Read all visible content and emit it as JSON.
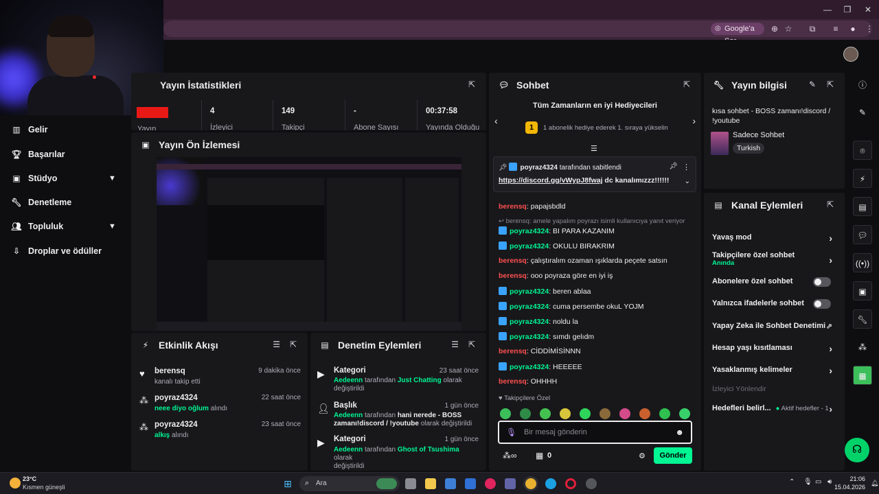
{
  "browser": {
    "google_sor_label": "Google'a Sor"
  },
  "sidebar": {
    "items": [
      {
        "label": "Gelir",
        "icon": "bar-chart-icon"
      },
      {
        "label": "Başarılar",
        "icon": "trophy-icon"
      },
      {
        "label": "Stüdyo",
        "icon": "studio-icon"
      },
      {
        "label": "Denetleme",
        "icon": "wrench-icon"
      },
      {
        "label": "Topluluk",
        "icon": "people-icon"
      },
      {
        "label": "Droplar ve ödüller",
        "icon": "gift-icon"
      }
    ]
  },
  "stats_panel": {
    "title": "Yayın İstatistikleri",
    "stats": [
      {
        "value": "4",
        "label": "İzleyici"
      },
      {
        "value": "149",
        "label": "Takipçi"
      },
      {
        "value": "-",
        "label": "Abone Sayısı"
      },
      {
        "value": "00:37:58",
        "label": "Yayında Olduğu"
      }
    ],
    "first_label": "Yayın"
  },
  "preview_panel": {
    "title": "Yayın Ön İzlemesi"
  },
  "activity_panel": {
    "title": "Etkinlik Akışı",
    "items": [
      {
        "name": "berensq",
        "sub": "kanalı takip etti",
        "time": "9 dakika önce",
        "icon": "heart-icon"
      },
      {
        "name": "poyraz4324",
        "sub_highlight": "neee diyo oğlum",
        "sub_rest": "alındı",
        "time": "22 saat önce",
        "icon": "points-icon"
      },
      {
        "name": "poyraz4324",
        "sub_highlight": "alkış",
        "sub_rest": "alındı",
        "time": "23 saat önce",
        "icon": "points-icon"
      }
    ]
  },
  "mod_panel": {
    "title": "Denetim Eylemleri",
    "items": [
      {
        "kind": "Kategori",
        "time": "23 saat önce",
        "user": "Aedeenn",
        "mid": "tarafından",
        "value": "Just Chatting",
        "rest1": "olarak",
        "rest2": "değiştirildi"
      },
      {
        "kind": "Başlık",
        "time": "1 gün önce",
        "user": "Aedeenn",
        "mid": "tarafından",
        "value": "hani nerede - BOSS",
        "value2": "zamanı!discord / !youtube",
        "rest1": "olarak değiştirildi"
      },
      {
        "kind": "Kategori",
        "time": "1 gün önce",
        "user": "Aedeenn",
        "mid": "tarafından",
        "value": "Ghost of Tsushima",
        "rest1": "olarak",
        "rest2": "değiştirildi"
      }
    ]
  },
  "chat_panel": {
    "title": "Sohbet",
    "gifters_title": "Tüm Zamanların en iyi Hediyecileri",
    "gift_rank": "1",
    "gift_text": "1 abonelik hediye ederek 1. sıraya yükselin",
    "pinned_by": "poyraz4324",
    "pinned_suffix": "tarafından sabitlendi",
    "pinned_link": "https://discord.gg/vWypJ8fwaj",
    "pinned_rest": "dc kanalımızzz!!!!!!",
    "reply_note": "berensq: amele yapalım poyrazı isimli kullanıcıya yanıt veriyor",
    "messages": [
      {
        "user": "berensq",
        "text": "papajsbdld",
        "type": "b"
      },
      {
        "user": "poyraz4324",
        "text": "BI PARA KAZANIM",
        "type": "p"
      },
      {
        "user": "poyraz4324",
        "text": "OKULU BIRAKRIM",
        "type": "p"
      },
      {
        "user": "berensq",
        "text": "çalıştıralım ozaman ışıklarda peçete satsın",
        "type": "b"
      },
      {
        "user": "berensq",
        "text": "ooo poyraza göre en iyi iş",
        "type": "b"
      },
      {
        "user": "poyraz4324",
        "text": "beren ablaa",
        "type": "p"
      },
      {
        "user": "poyraz4324",
        "text": "cuma persembe okuL YOJM",
        "type": "p"
      },
      {
        "user": "poyraz4324",
        "text": "noldu la",
        "type": "p"
      },
      {
        "user": "poyraz4324",
        "text": "sımdı gelıdm",
        "type": "p"
      },
      {
        "user": "berensq",
        "text": "CİDDİMİSİNNN",
        "type": "b"
      },
      {
        "user": "poyraz4324",
        "text": "HEEEEE",
        "type": "p"
      },
      {
        "user": "berensq",
        "text": "OHHHH",
        "type": "b"
      }
    ],
    "followers_only": "Takipçilere Özel",
    "input_placeholder": "Bir mesaj gönderin",
    "points": "0",
    "send_label": "Gönder"
  },
  "info_panel": {
    "title": "Yayın bilgisi",
    "stream_title": "kısa sohbet - BOSS zamanı!discord / !youtube",
    "category": "Sadece Sohbet",
    "tag": "Turkish"
  },
  "channel_actions": {
    "title": "Kanal Eylemleri",
    "rows": [
      {
        "label": "Yavaş mod",
        "control": "chevron"
      },
      {
        "label": "Takipçilere özel sohbet",
        "sub": "Anında",
        "control": "chevron"
      },
      {
        "label": "Abonelere özel sohbet",
        "control": "toggle"
      },
      {
        "label": "Yalnızca ifadelerle sohbet",
        "control": "toggle"
      },
      {
        "label": "Yapay Zeka ile Sohbet Denetimi",
        "control": "external"
      },
      {
        "label": "Hesap yaşı kısıtlaması",
        "control": "chevron"
      },
      {
        "label": "Yasaklanmış kelimeler",
        "control": "chevron"
      }
    ],
    "section": "İzleyici Yönlendir",
    "goals_label": "Hedefleri belirl...",
    "goals_status": "Aktif hedefler - 1"
  },
  "taskbar": {
    "temp": "23°C",
    "weather": "Kısmen güneşli",
    "search": "Ara",
    "time": "21:06",
    "date": "15.04.2026"
  }
}
